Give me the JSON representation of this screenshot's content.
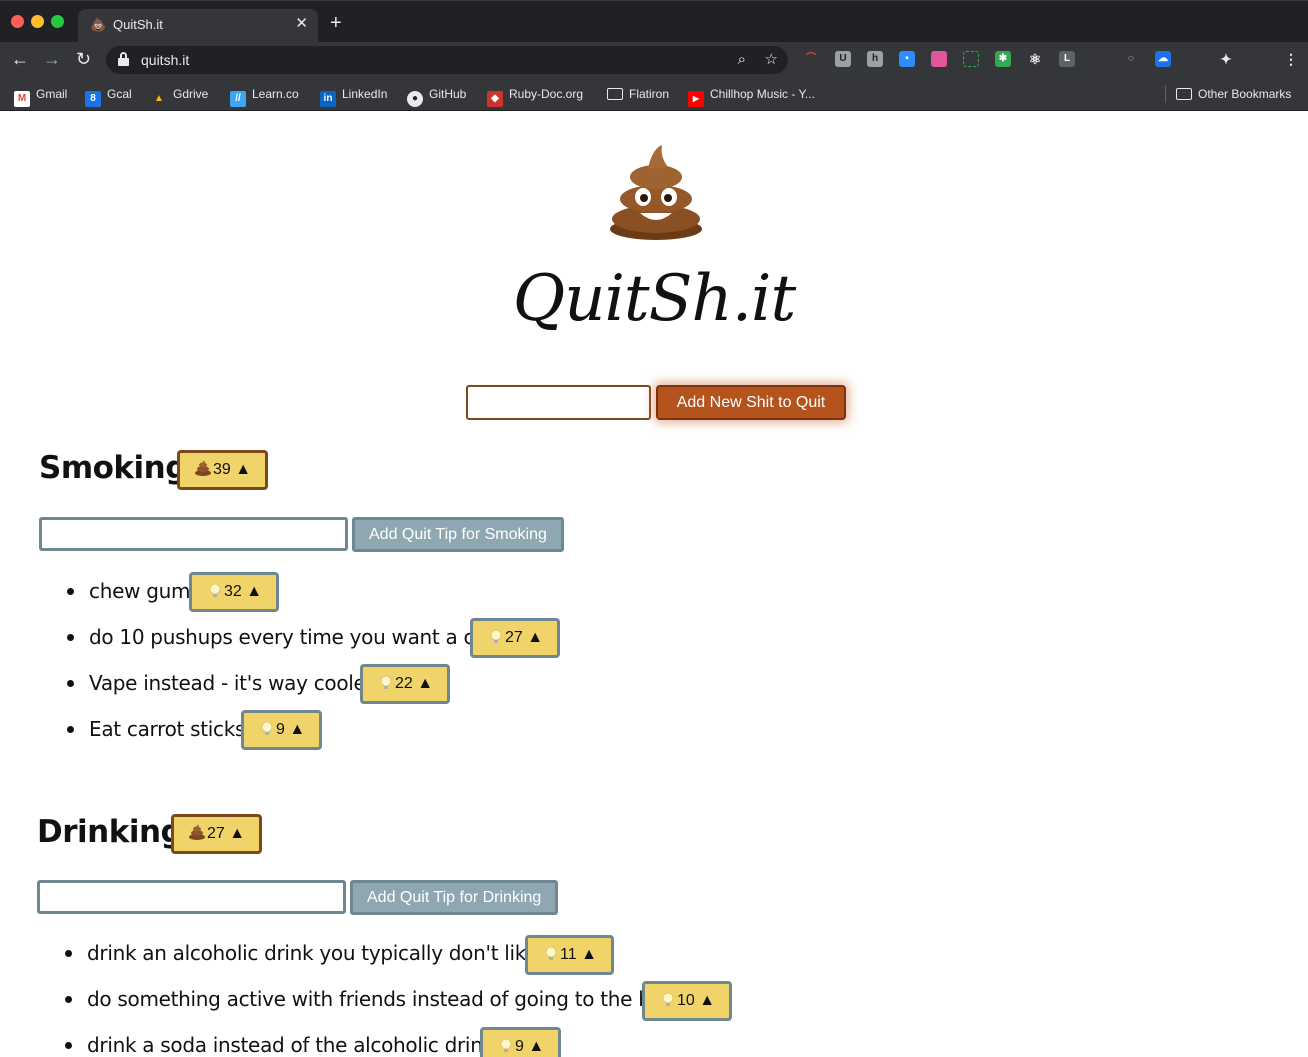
{
  "browser": {
    "tab_title": "QuitSh.it",
    "tab_favicon": "💩",
    "url": "quitsh.it",
    "bookmarks": [
      {
        "label": "Gmail",
        "icon": "gmail-icon",
        "color": "#ea4335",
        "glyph": "M"
      },
      {
        "label": "Gcal",
        "icon": "calendar-icon",
        "color": "#1a73e8",
        "glyph": "8"
      },
      {
        "label": "Gdrive",
        "icon": "drive-icon",
        "color": "#34a853",
        "glyph": "▲"
      },
      {
        "label": "Learn.co",
        "icon": "learn-icon",
        "color": "#3da6f2",
        "glyph": "//"
      },
      {
        "label": "LinkedIn",
        "icon": "linkedin-icon",
        "color": "#0a66c2",
        "glyph": "in"
      },
      {
        "label": "GitHub",
        "icon": "github-icon",
        "color": "#e8eaed",
        "glyph": "●"
      },
      {
        "label": "Ruby-Doc.org",
        "icon": "ruby-icon",
        "color": "#cc342d",
        "glyph": "◆"
      },
      {
        "label": "Flatiron",
        "icon": "folder-icon",
        "color": "",
        "glyph": ""
      },
      {
        "label": "Chillhop Music - Y...",
        "icon": "youtube-icon",
        "color": "#ff0000",
        "glyph": "▶"
      }
    ],
    "other_bookmarks": "Other Bookmarks"
  },
  "app": {
    "logo_emoji": "💩",
    "title": "QuitSh.it",
    "add_button": "Add New Shit to Quit",
    "accent_color": "#b5531d",
    "vote_color": "#f0d46a"
  },
  "categories": [
    {
      "name": "Smoking",
      "votes": "39",
      "add_tip_button": "Add Quit Tip for Smoking",
      "tips": [
        {
          "text": "chew gum",
          "votes": "32"
        },
        {
          "text": "do 10 pushups every time you want a cig",
          "votes": "27"
        },
        {
          "text": "Vape instead - it's way cooler",
          "votes": "22"
        },
        {
          "text": "Eat carrot sticks",
          "votes": "9"
        }
      ]
    },
    {
      "name": "Drinking",
      "votes": "27",
      "add_tip_button": "Add Quit Tip for Drinking",
      "tips": [
        {
          "text": "drink an alcoholic drink you typically don't like",
          "votes": "11"
        },
        {
          "text": "do something active with friends instead of going to the bar",
          "votes": "10"
        },
        {
          "text": "drink a soda instead of the alcoholic drink",
          "votes": "9"
        }
      ]
    }
  ],
  "upvote_glyph": "▲"
}
